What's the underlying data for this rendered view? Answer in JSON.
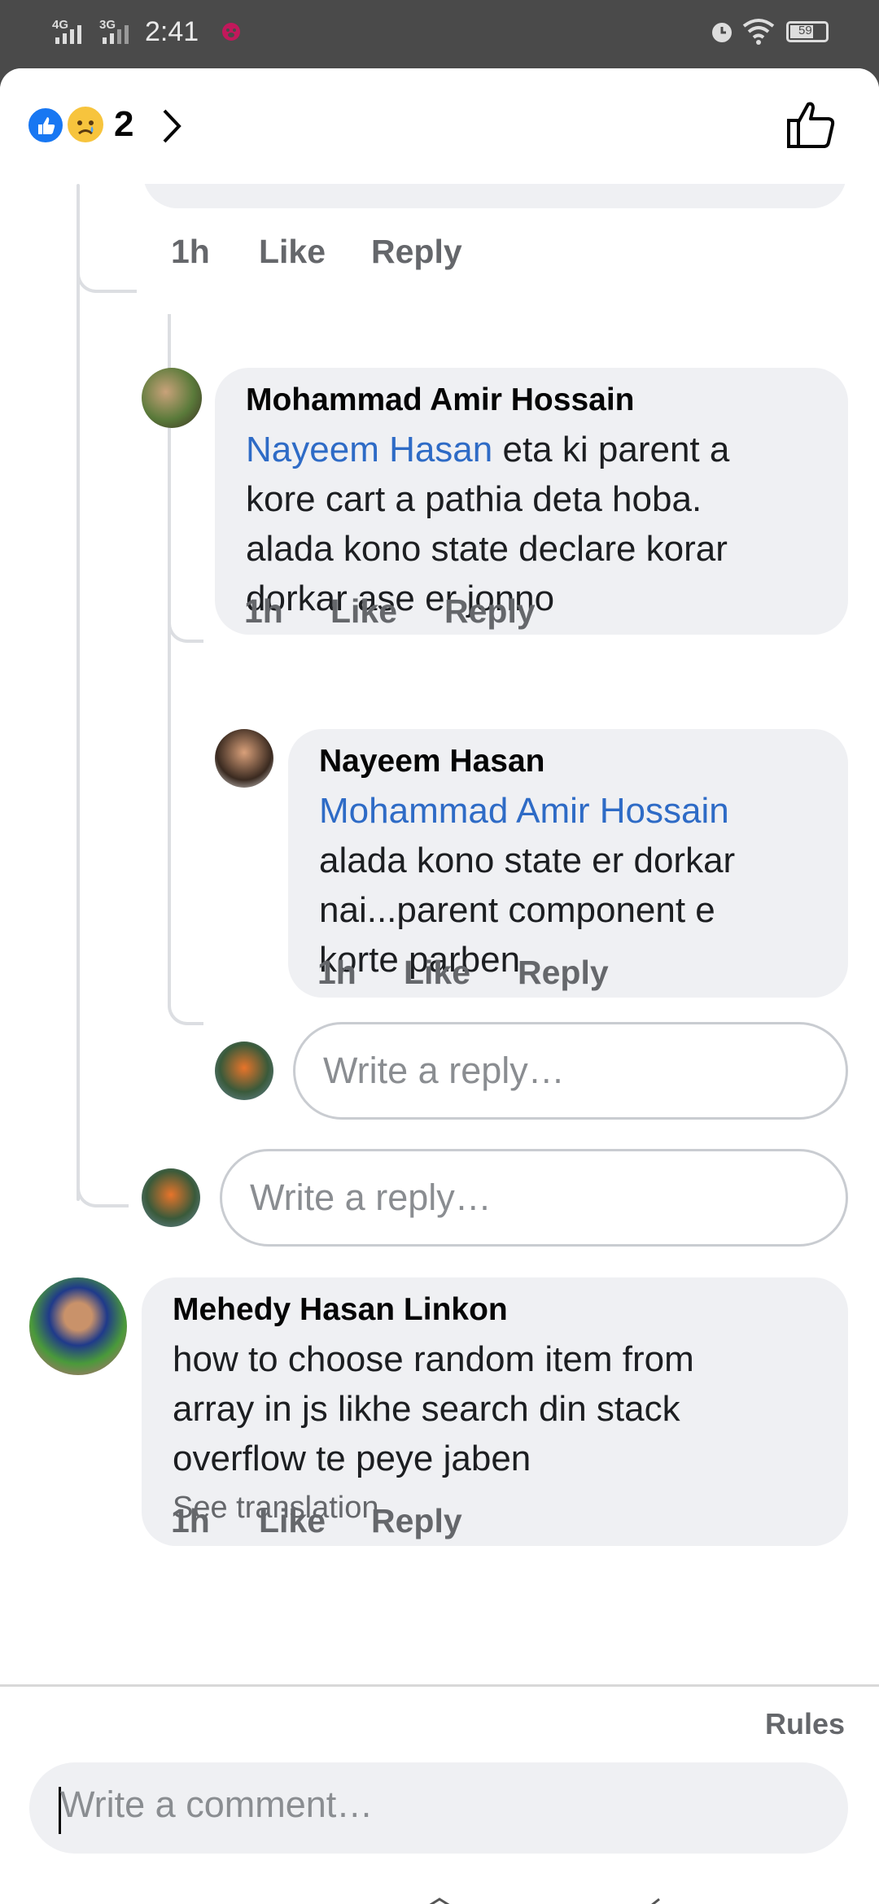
{
  "status_bar": {
    "network1": "4G",
    "network2": "3G",
    "time": "2:41",
    "battery": "59"
  },
  "reactions": {
    "count": "2",
    "icons": [
      "like-reaction-icon",
      "sad-reaction-icon"
    ]
  },
  "comments": {
    "c1_meta": {
      "time": "1h",
      "like": "Like",
      "reply": "Reply"
    },
    "c2": {
      "author": "Mohammad Amir Hossain",
      "mention": "Nayeem Hasan",
      "line1_rest": " eta ki parent a",
      "line2": "kore cart a pathia deta hoba.",
      "line3": "alada kono state declare korar",
      "line4": "dorkar ase er jonno",
      "time": "1h",
      "like": "Like",
      "reply": "Reply"
    },
    "c3": {
      "author": "Nayeem Hasan",
      "mention": "Mohammad Amir Hossain",
      "line2": "alada kono state er dorkar",
      "line3": "nai...parent component e",
      "line4": "korte parben",
      "time": "1h",
      "like": "Like",
      "reply": "Reply"
    },
    "reply_placeholder": "Write a reply…",
    "c4": {
      "author": "Mehedy Hasan Linkon",
      "line1": "how to choose random item from",
      "line2": "array in js likhe search din stack",
      "line3": "overflow te peye jaben",
      "see_translation": "See translation",
      "time": "1h",
      "like": "Like",
      "reply": "Reply"
    }
  },
  "footer": {
    "rules": "Rules",
    "comment_placeholder": "Write a comment…"
  },
  "colors": {
    "accent_link": "#2e6bc6",
    "bubble": "#eff0f3",
    "meta": "#65676b",
    "like_blue": "#1877f2"
  }
}
